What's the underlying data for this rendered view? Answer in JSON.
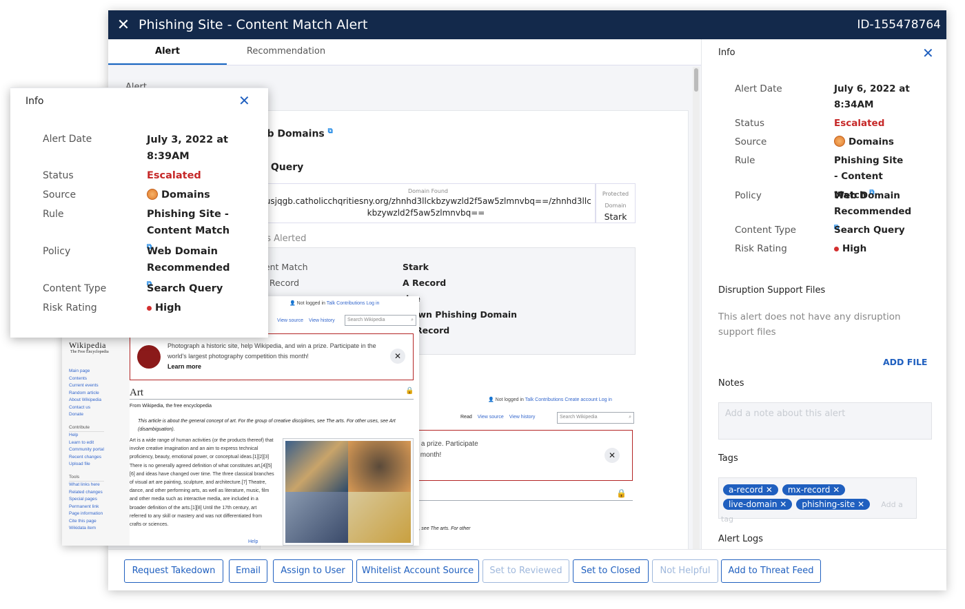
{
  "window": {
    "title": "Phishing Site - Content Match Alert",
    "id": "ID-155478764"
  },
  "tabs": [
    "Alert",
    "Recommendation"
  ],
  "alert_card": {
    "section_label": "Alert",
    "heading1": "eb Domains",
    "heading2": "n Query",
    "domain_found_label": "Domain Found",
    "domain_found": "kusjqgb.catholicchqritiesny.org/zhnhd3llckbzywzld2f5aw5zlmnvbq==/zhnhd3llckbzywzld2f5aw5zlmnvbq==",
    "protected_label": "Protected Domain",
    "protected_value": "Stark",
    "alerted_label": "ns Alerted",
    "alerted": [
      {
        "k": "tent Match",
        "v": "Stark"
      },
      {
        "k": "S Record",
        "v": "A Record"
      },
      {
        "k": "",
        "v": "ive"
      },
      {
        "k": "",
        "v": "nown Phishing Domain"
      },
      {
        "k": "",
        "v": "X Record"
      }
    ]
  },
  "right_panel": {
    "title": "Info",
    "fields": [
      {
        "k": "Alert Date",
        "v": "July 6, 2022 at 8:34AM"
      },
      {
        "k": "Status",
        "v": "Escalated"
      },
      {
        "k": "Source",
        "v": "Domains"
      },
      {
        "k": "Rule",
        "v": "Phishing Site - Content Match"
      },
      {
        "k": "Policy",
        "v": "Web Domain Recommended"
      },
      {
        "k": "Content Type",
        "v": "Search Query"
      },
      {
        "k": "Risk Rating",
        "v": "High"
      }
    ],
    "disruption_title": "Disruption Support Files",
    "disruption_text": "This alert does not have any disruption support files",
    "add_file": "ADD FILE",
    "notes_title": "Notes",
    "notes_placeholder": "Add a note about this alert",
    "tags_title": "Tags",
    "tags": [
      "a-record",
      "mx-record",
      "live-domain",
      "phishing-site"
    ],
    "tag_placeholder": "Add a tag",
    "logs_title": "Alert Logs"
  },
  "floating_info": {
    "title": "Info",
    "fields": [
      {
        "k": "Alert Date",
        "v": "July 3, 2022 at 8:39AM"
      },
      {
        "k": "Status",
        "v": "Escalated"
      },
      {
        "k": "Source",
        "v": "Domains"
      },
      {
        "k": "Rule",
        "v": "Phishing Site - Content Match"
      },
      {
        "k": "Policy",
        "v": "Web Domain Recommended"
      },
      {
        "k": "Content Type",
        "v": "Search Query"
      },
      {
        "k": "Risk Rating",
        "v": "High"
      }
    ]
  },
  "actions": [
    {
      "label": "Request Takedown",
      "enabled": true
    },
    {
      "label": "Email",
      "enabled": true
    },
    {
      "label": "Assign to User",
      "enabled": true
    },
    {
      "label": "Whitelist Account Source",
      "enabled": true
    },
    {
      "label": "Set to Reviewed",
      "enabled": false
    },
    {
      "label": "Set to Closed",
      "enabled": true
    },
    {
      "label": "Not Helpful",
      "enabled": false
    },
    {
      "label": "Add to Threat Feed",
      "enabled": true
    }
  ],
  "wikipedia": {
    "logo": "Wikipedia",
    "tagline": "The Free Encyclopedia",
    "personal": [
      "Not logged in",
      "Talk",
      "Contributions",
      "Create account",
      "Log in"
    ],
    "views": [
      "Read",
      "View source",
      "View history"
    ],
    "search_placeholder": "Search Wikipedia",
    "banner": "Photograph a historic site, help Wikipedia, and win a prize. Participate in the world's largest photography competition this month!",
    "banner_link": "Learn more",
    "banner_partial": "oric site, help Wikipedia, and win a prize. Participate",
    "banner_partial2": "est photography competition this month!",
    "title": "Art",
    "from": "From Wikipedia, the free encyclopedia",
    "hatnote": "This article is about the general concept of art. For the group of creative disciplines, see The arts. For other uses, see Art (disambiguation).",
    "hatnote_partial": "ncept of art. For the group of creative disciplines, see The arts. For other",
    "body": "Art is a wide range of human activities (or the products thereof) that involve creative imagination and an aim to express technical proficiency, beauty, emotional power, or conceptual ideas.[1][2][3] There is no generally agreed definition of what constitutes art,[4][5][6] and ideas have changed over time. The three classical branches of visual art are painting, sculpture, and architecture.[7] Theatre, dance, and other performing arts, as well as literature, music, film and other media such as interactive media, are included in a broader definition of the arts.[1][8] Until the 17th century, art referred to any skill or mastery and was not differentiated from crafts or sciences.",
    "body_partial": "Art is a wide range of human activities (or the products",
    "nav": [
      "Main page",
      "Contents",
      "Current events",
      "Random article",
      "About Wikipedia",
      "Contact us",
      "Donate"
    ],
    "contribute_title": "Contribute",
    "contribute": [
      "Help",
      "Learn to edit",
      "Community portal",
      "Recent changes",
      "Upload file"
    ],
    "tools_title": "Tools",
    "tools": [
      "What links here",
      "Related changes",
      "Special pages",
      "Permanent link",
      "Page information",
      "Cite this page",
      "Wikidata item"
    ],
    "help": "Help"
  },
  "colors": {
    "header": "#13294b",
    "accent": "#1f5fbf",
    "escalated": "#c62828",
    "high": "#d32f2f"
  }
}
